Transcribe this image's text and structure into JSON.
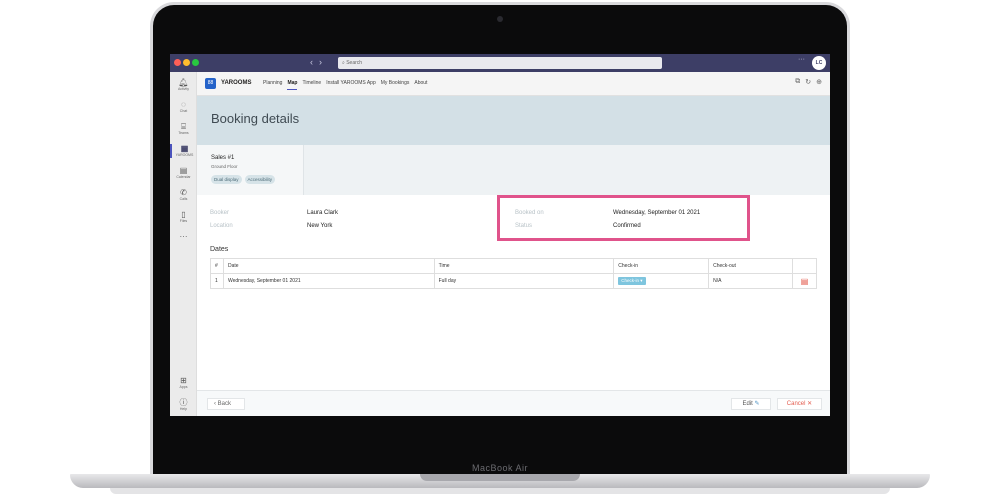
{
  "device": {
    "label": "MacBook Air"
  },
  "colors": {
    "teams_purple": "#3d3e66",
    "highlight_pink": "#e0538b",
    "header_band": "#d3e0e6",
    "checkin_blue": "#7ec5de",
    "cancel_red": "#e35d4f"
  },
  "titlebar": {
    "back_arrow": "‹",
    "forward_arrow": "›",
    "search_placeholder": "Search",
    "more": "···",
    "avatar_initials": "LC"
  },
  "rail": {
    "items": [
      {
        "label": "Activity",
        "icon": "bell-icon"
      },
      {
        "label": "Chat",
        "icon": "chat-icon"
      },
      {
        "label": "Teams",
        "icon": "teams-icon"
      },
      {
        "label": "YAROOMS",
        "icon": "yarooms-icon"
      },
      {
        "label": "Calendar",
        "icon": "calendar-icon"
      },
      {
        "label": "Calls",
        "icon": "phone-icon"
      },
      {
        "label": "Files",
        "icon": "file-icon"
      }
    ],
    "more": "···",
    "bottom": [
      {
        "label": "Apps",
        "icon": "apps-icon"
      },
      {
        "label": "Help",
        "icon": "help-icon"
      }
    ]
  },
  "app": {
    "logo_text": "88",
    "name": "YAROOMS",
    "tabs": [
      "Planning",
      "Map",
      "Timeline",
      "Install YAROOMS App",
      "My Bookings",
      "About"
    ],
    "active_tab": "Map"
  },
  "page": {
    "title": "Booking details"
  },
  "room": {
    "name": "Sales #1",
    "floor": "Ground Floor",
    "tags": [
      "Dual display",
      "Accessibility"
    ]
  },
  "details": {
    "booker_label": "Booker",
    "booker_value": "Laura Clark",
    "location_label": "Location",
    "location_value": "New York",
    "booked_on_label": "Booked on",
    "booked_on_value": "Wednesday, September 01 2021",
    "status_label": "Status",
    "status_value": "Confirmed"
  },
  "dates": {
    "title": "Dates",
    "columns": [
      "#",
      "Date",
      "Time",
      "Check-in",
      "Check-out"
    ],
    "rows": [
      {
        "num": "1",
        "date": "Wednesday, September 01 2021",
        "time": "Full day",
        "checkin": "Check-in",
        "checkout": "N/A"
      }
    ]
  },
  "footer": {
    "back": "Back",
    "edit": "Edit",
    "cancel": "Cancel"
  }
}
